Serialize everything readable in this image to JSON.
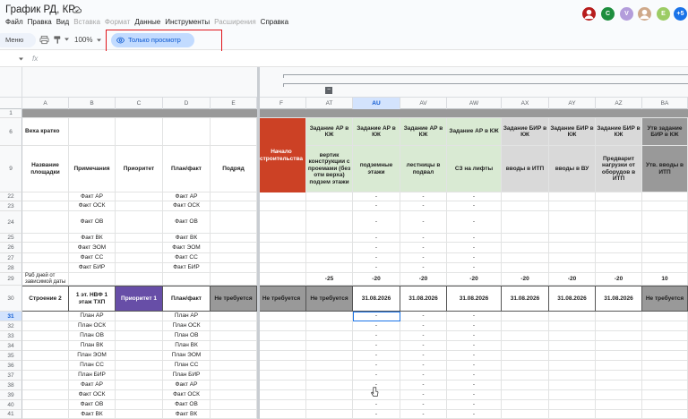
{
  "doc": {
    "title": "График РД, КР",
    "cloud_icon": "cloud-done-icon"
  },
  "menu": {
    "items": [
      {
        "label": "Файл",
        "enabled": true
      },
      {
        "label": "Правка",
        "enabled": true
      },
      {
        "label": "Вид",
        "enabled": true
      },
      {
        "label": "Вставка",
        "enabled": false
      },
      {
        "label": "Формат",
        "enabled": false
      },
      {
        "label": "Данные",
        "enabled": true
      },
      {
        "label": "Инструменты",
        "enabled": true
      },
      {
        "label": "Расширения",
        "enabled": false
      },
      {
        "label": "Справка",
        "enabled": true
      }
    ]
  },
  "avatars": [
    {
      "letter": "",
      "color": "#b71c1c",
      "icon": "user-photo-icon"
    },
    {
      "letter": "C",
      "color": "#1e8e3e",
      "icon": ""
    },
    {
      "letter": "V",
      "color": "#b39ddb",
      "icon": ""
    },
    {
      "letter": "",
      "color": "#cfa98a",
      "icon": "user-photo-icon"
    },
    {
      "letter": "E",
      "color": "#9ccc65",
      "icon": ""
    },
    {
      "letter": "+5",
      "color": "#1a73e8",
      "icon": ""
    }
  ],
  "toolbar": {
    "menu_search": "Меню",
    "zoom": "100%",
    "view_only": "Только просмотр"
  },
  "formula": {
    "fx": "fx"
  },
  "columns": [
    {
      "letter": "",
      "selected": false
    },
    {
      "letter": "A",
      "selected": false
    },
    {
      "letter": "B",
      "selected": false
    },
    {
      "letter": "C",
      "selected": false
    },
    {
      "letter": "D",
      "selected": false
    },
    {
      "letter": "E",
      "selected": false
    },
    {
      "letter": "F",
      "selected": false
    },
    {
      "letter": "AT",
      "selected": false
    },
    {
      "letter": "AU",
      "selected": true
    },
    {
      "letter": "AV",
      "selected": false
    },
    {
      "letter": "AW",
      "selected": false
    },
    {
      "letter": "AX",
      "selected": false
    },
    {
      "letter": "AY",
      "selected": false
    },
    {
      "letter": "AZ",
      "selected": false
    },
    {
      "letter": "BA",
      "selected": false
    }
  ],
  "rows": [
    {
      "num": "1",
      "selected": false,
      "cells": [
        "",
        "",
        "",
        "",
        "",
        "",
        "",
        "",
        "",
        "",
        "",
        "",
        "",
        ""
      ]
    },
    {
      "num": "6",
      "selected": false,
      "cells": [
        "Веха кратко",
        "",
        "",
        "",
        "",
        "Начало строительства",
        "Задание АР в КЖ",
        "Задание АР в КЖ",
        "Задание АР в КЖ",
        "Задание АР в КЖ",
        "Задание БИР в КЖ",
        "Задание БИР в КЖ",
        "Задание БИР в КЖ",
        "Утв задание БИР в КЖ"
      ]
    },
    {
      "num": "9",
      "selected": false,
      "cells": [
        "Название площадки",
        "Примечания",
        "Приоритет",
        "План/факт",
        "Подряд",
        "",
        "вертик конструкции с проемами (без отм верха) подзем этажи",
        "подземные этажи",
        "лестницы в подвал",
        "СЗ на лифты",
        "вводы в ИТП",
        "вводы в ВУ",
        "Предварит нагрузки от оборудов в ИТП",
        "Утв. вводы в ИТП"
      ]
    },
    {
      "num": "22",
      "selected": false,
      "cells": [
        "",
        "Факт АР",
        "",
        "Факт АР",
        "",
        "",
        "",
        "-",
        "-",
        "-",
        "",
        "",
        "",
        ""
      ]
    },
    {
      "num": "23",
      "selected": false,
      "cells": [
        "",
        "Факт ОСК",
        "",
        "Факт ОСК",
        "",
        "",
        "",
        "-",
        "-",
        "-",
        "",
        "",
        "",
        ""
      ]
    },
    {
      "num": "24",
      "selected": false,
      "cells": [
        "",
        "Факт ОВ",
        "",
        "Факт ОВ",
        "",
        "",
        "",
        "-",
        "-",
        "-",
        "",
        "",
        "",
        ""
      ]
    },
    {
      "num": "25",
      "selected": false,
      "cells": [
        "",
        "Факт ВК",
        "",
        "Факт ВК",
        "",
        "",
        "",
        "-",
        "-",
        "-",
        "",
        "",
        "",
        ""
      ]
    },
    {
      "num": "26",
      "selected": false,
      "cells": [
        "",
        "Факт ЭОМ",
        "",
        "Факт ЭОМ",
        "",
        "",
        "",
        "-",
        "-",
        "-",
        "",
        "",
        "",
        ""
      ]
    },
    {
      "num": "27",
      "selected": false,
      "cells": [
        "",
        "Факт СС",
        "",
        "Факт СС",
        "",
        "",
        "",
        "-",
        "-",
        "-",
        "",
        "",
        "",
        ""
      ]
    },
    {
      "num": "28",
      "selected": false,
      "cells": [
        "",
        "Факт БИР",
        "",
        "Факт БИР",
        "",
        "",
        "",
        "-",
        "-",
        "-",
        "",
        "",
        "",
        ""
      ]
    },
    {
      "num": "29",
      "selected": false,
      "cells": [
        "Раб дней от зависимой даты",
        "",
        "",
        "",
        "",
        "",
        "-25",
        "-20",
        "-20",
        "-20",
        "-20",
        "-20",
        "-20",
        "10"
      ]
    },
    {
      "num": "30",
      "selected": false,
      "cells": [
        "Строение 2",
        "1 эт. НВФ 1 этаж ТХП",
        "Приоритет 1",
        "План/факт",
        "Не требуется",
        "Не требуется",
        "Не требуется",
        "31.08.2026",
        "31.08.2026",
        "31.08.2026",
        "31.08.2026",
        "31.08.2026",
        "31.08.2026",
        "Не требуется"
      ]
    },
    {
      "num": "31",
      "selected": true,
      "cells": [
        "",
        "План АР",
        "",
        "План АР",
        "",
        "",
        "",
        "-",
        "-",
        "-",
        "",
        "",
        "",
        ""
      ]
    },
    {
      "num": "32",
      "selected": false,
      "cells": [
        "",
        "План ОСК",
        "",
        "План ОСК",
        "",
        "",
        "",
        "-",
        "-",
        "-",
        "",
        "",
        "",
        ""
      ]
    },
    {
      "num": "33",
      "selected": false,
      "cells": [
        "",
        "План ОВ",
        "",
        "План ОВ",
        "",
        "",
        "",
        "-",
        "-",
        "-",
        "",
        "",
        "",
        ""
      ]
    },
    {
      "num": "34",
      "selected": false,
      "cells": [
        "",
        "План ВК",
        "",
        "План ВК",
        "",
        "",
        "",
        "-",
        "-",
        "-",
        "",
        "",
        "",
        ""
      ]
    },
    {
      "num": "35",
      "selected": false,
      "cells": [
        "",
        "План ЭОМ",
        "",
        "План ЭОМ",
        "",
        "",
        "",
        "-",
        "-",
        "-",
        "",
        "",
        "",
        ""
      ]
    },
    {
      "num": "36",
      "selected": false,
      "cells": [
        "",
        "План СС",
        "",
        "План СС",
        "",
        "",
        "",
        "-",
        "-",
        "-",
        "",
        "",
        "",
        ""
      ]
    },
    {
      "num": "37",
      "selected": false,
      "cells": [
        "",
        "План БИР",
        "",
        "План БИР",
        "",
        "",
        "",
        "-",
        "-",
        "-",
        "",
        "",
        "",
        ""
      ]
    },
    {
      "num": "38",
      "selected": false,
      "cells": [
        "",
        "Факт АР",
        "",
        "Факт АР",
        "",
        "",
        "",
        "-",
        "-",
        "-",
        "",
        "",
        "",
        ""
      ]
    },
    {
      "num": "39",
      "selected": false,
      "cells": [
        "",
        "Факт ОСК",
        "",
        "Факт ОСК",
        "",
        "",
        "",
        "-",
        "-",
        "-",
        "",
        "",
        "",
        ""
      ]
    },
    {
      "num": "40",
      "selected": false,
      "cells": [
        "",
        "Факт ОВ",
        "",
        "Факт ОВ",
        "",
        "",
        "",
        "-",
        "-",
        "-",
        "",
        "",
        "",
        ""
      ]
    },
    {
      "num": "41",
      "selected": false,
      "cells": [
        "",
        "Факт ВК",
        "",
        "Факт ВК",
        "",
        "",
        "",
        "-",
        "-",
        "-",
        "",
        "",
        "",
        ""
      ]
    }
  ],
  "colors": {
    "red_header": "#cc4125",
    "green_header": "#d9ead3",
    "grey_header": "#d9d9d9",
    "dark_grey_header": "#999999",
    "row1_band": "#999999",
    "purple_priority": "#674ea7",
    "grey_cell": "#999999",
    "selection": "#1a73e8",
    "highlight_box": "#e0141a"
  }
}
